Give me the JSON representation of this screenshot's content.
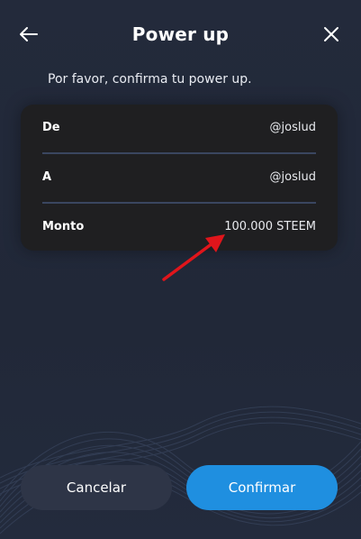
{
  "header": {
    "title": "Power up",
    "back_icon": "arrow-left-icon",
    "close_icon": "close-icon"
  },
  "subtitle": "Por favor, confirma tu power up.",
  "details": {
    "rows": [
      {
        "label": "De",
        "value": "@joslud"
      },
      {
        "label": "A",
        "value": "@joslud"
      },
      {
        "label": "Monto",
        "value": "100.000 STEEM"
      }
    ]
  },
  "buttons": {
    "cancel_label": "Cancelar",
    "confirm_label": "Confirmar"
  },
  "colors": {
    "background": "#222a3a",
    "card": "#1f1f21",
    "accent": "#1f8fe0",
    "secondary_button": "#2e3547",
    "annotation_arrow": "#e0151b"
  }
}
